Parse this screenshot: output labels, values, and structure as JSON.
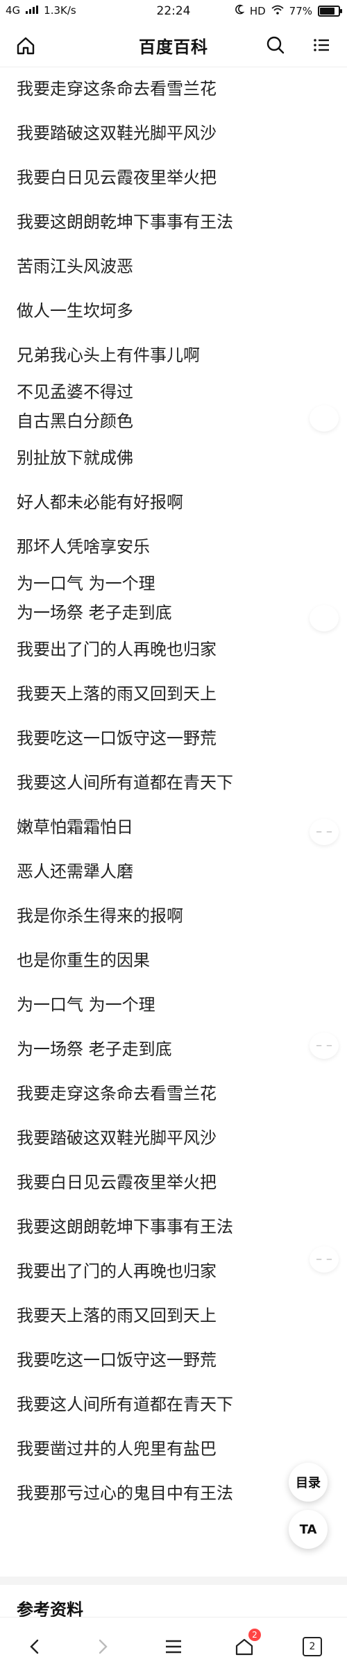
{
  "status_bar": {
    "network": "4G",
    "speed": "1.3K/s",
    "time": "22:24",
    "right_text": "HD",
    "battery": "77%",
    "battery_level": 0.77
  },
  "top_nav": {
    "title": "百度百科",
    "icons": [
      "home-icon",
      "search-icon",
      "menu-icon"
    ]
  },
  "lyrics": [
    "我要走穿这条命去看雪兰花",
    "我要踏破这双鞋光脚平风沙",
    "我要白日见云霞夜里举火把",
    "我要这朗朗乾坤下事事有王法",
    "苦雨江头风波恶",
    "做人一生坎坷多",
    "兄弟我心头上有件事儿啊",
    "不见孟婆不得过",
    "自古黑白分颜色",
    "别扯放下就成佛",
    "好人都未必能有好报啊",
    "那坏人凭啥享安乐",
    "为一口气 为一个理",
    "为一场祭 老子走到底",
    "我要出了门的人再晚也归家",
    "我要天上落的雨又回到天上",
    "我要吃这一口饭守这一野荒",
    "我要这人间所有道都在青天下",
    "嫩草怕霜霜怕日",
    "恶人还需犟人磨",
    "我是你杀生得来的报啊",
    "也是你重生的因果",
    "为一口气 为一个理",
    "为一场祭 老子走到底",
    "我要走穿这条命去看雪兰花",
    "我要踏破这双鞋光脚平风沙",
    "我要白日见云霞夜里举火把",
    "我要这朗朗乾坤下事事有王法",
    "我要出了门的人再晚也归家",
    "我要天上落的雨又回到天上",
    "我要吃这一口饭守这一野荒",
    "我要这人间所有道都在青天下",
    "我要凿过井的人兜里有盐巴",
    "我要那亏过心的鬼目中有王法"
  ],
  "floating": {
    "toc_label": "目录",
    "ta_label": "TA"
  },
  "reference_title": "参考资料",
  "bottom_bar": {
    "tabs_badge": "2",
    "tabs_count": "2"
  }
}
